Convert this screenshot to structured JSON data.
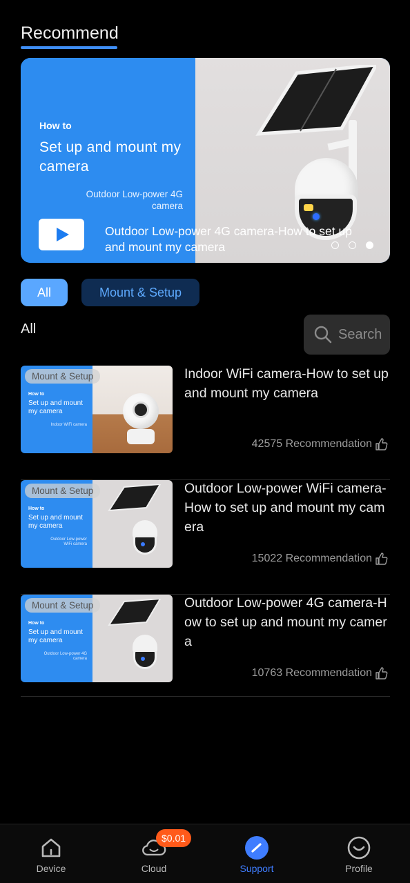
{
  "recommend": {
    "title": "Recommend",
    "banner": {
      "how_to": "How to",
      "heading": "Set up and mount my camera",
      "subheading": "Outdoor Low-power 4G camera",
      "caption": "Outdoor Low-power 4G camera-How to set up and mount my camera",
      "slide_count": 3,
      "active_slide": 3
    }
  },
  "filters": {
    "chips": [
      {
        "label": "All",
        "selected": true
      },
      {
        "label": "Mount & Setup",
        "selected": false
      }
    ]
  },
  "list": {
    "title": "All",
    "search_label": "Search",
    "items": [
      {
        "tag": "Mount & Setup",
        "thumb_how_to": "How to",
        "thumb_heading": "Set up and mount my camera",
        "thumb_sub": "Indoor WiFi camera",
        "title": "Indoor WiFi camera-How to set up and mount my camera",
        "recommendation": "42575 Recommendation"
      },
      {
        "tag": "Mount & Setup",
        "thumb_how_to": "How to",
        "thumb_heading": "Set up and mount my camera",
        "thumb_sub": "Outdoor Low-power WiFi camera",
        "title": "Outdoor Low-power WiFi camera-How to set up and mount my camera",
        "recommendation": "15022 Recommendation"
      },
      {
        "tag": "Mount & Setup",
        "thumb_how_to": "How to",
        "thumb_heading": "Set up and mount my camera",
        "thumb_sub": "Outdoor Low-power 4G camera",
        "title": "Outdoor Low-power 4G camera-How to set up and mount my camera",
        "recommendation": "10763 Recommendation"
      }
    ]
  },
  "tabbar": {
    "tabs": [
      {
        "label": "Device",
        "icon": "house-icon",
        "active": false
      },
      {
        "label": "Cloud",
        "icon": "cloud-icon",
        "active": false
      },
      {
        "label": "Support",
        "icon": "compass-icon",
        "active": true
      },
      {
        "label": "Profile",
        "icon": "smiley-icon",
        "active": false
      }
    ],
    "cloud_badge": "$0.01"
  },
  "colors": {
    "accent": "#3f7dff",
    "banner_blue": "#2d8cf0",
    "chip_selected": "#5aa7ff",
    "chip_unselected": "#0f2c52",
    "badge": "#ff5a1a"
  }
}
